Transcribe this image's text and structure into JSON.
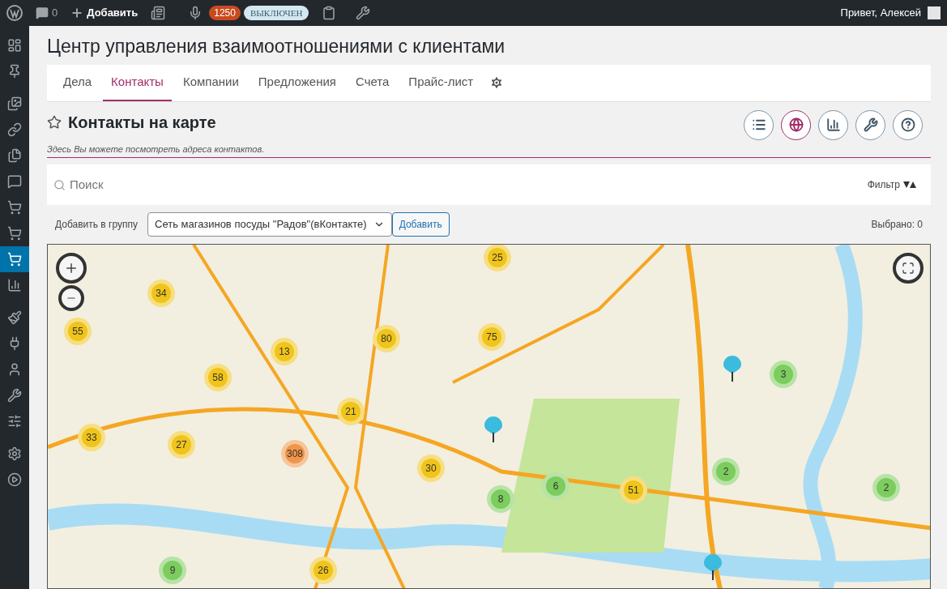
{
  "admin_bar": {
    "comments_count": "0",
    "add_label": "Добавить",
    "badge": "1250",
    "status_pill": "ВЫКЛЮЧЕН",
    "greeting": "Привет, Алексей"
  },
  "sidebar": {
    "items": [
      {
        "selected": false
      },
      {
        "selected": false
      },
      {
        "selected": false
      },
      {
        "selected": false
      },
      {
        "selected": false
      },
      {
        "selected": false
      },
      {
        "selected": false
      },
      {
        "selected": false
      },
      {
        "selected": true
      },
      {
        "selected": false
      },
      {
        "selected": false
      },
      {
        "selected": false
      },
      {
        "selected": false
      },
      {
        "selected": false
      },
      {
        "selected": false
      },
      {
        "selected": false
      },
      {
        "selected": false
      }
    ]
  },
  "page_title": "Центр управления взаимоотношениями с клиентами",
  "tabs": [
    {
      "label": "Дела",
      "selected": false
    },
    {
      "label": "Контакты",
      "selected": true
    },
    {
      "label": "Компании",
      "selected": false
    },
    {
      "label": "Предложения",
      "selected": false
    },
    {
      "label": "Счета",
      "selected": false
    },
    {
      "label": "Прайс-лист",
      "selected": false
    }
  ],
  "section": {
    "title": "Контакты на карте",
    "subtitle": "Здесь Вы можете посмотреть адреса контактов.",
    "view_buttons": [
      {
        "selected": false
      },
      {
        "selected": true
      },
      {
        "selected": false
      },
      {
        "selected": false
      },
      {
        "selected": false
      }
    ]
  },
  "search": {
    "placeholder": "Поиск",
    "filter_label": "Фильтр"
  },
  "group_bar": {
    "label": "Добавить в группу",
    "select_value": "Сеть магазинов посуды \"Радов\"(вКонтакте)",
    "button": "Добавить",
    "selected_count": "Выбрано: 0"
  },
  "map": {
    "clusters": [
      {
        "count": "34",
        "color": "#f0c419"
      },
      {
        "count": "55",
        "color": "#f0c419"
      },
      {
        "count": "13",
        "color": "#f0c419"
      },
      {
        "count": "80",
        "color": "#f0c419"
      },
      {
        "count": "25",
        "color": "#f0c419"
      },
      {
        "count": "75",
        "color": "#f0c419"
      },
      {
        "count": "58",
        "color": "#f0c419"
      },
      {
        "count": "21",
        "color": "#f0c419"
      },
      {
        "count": "33",
        "color": "#f0c419"
      },
      {
        "count": "27",
        "color": "#f0c419"
      },
      {
        "count": "308",
        "color": "#f0954a"
      },
      {
        "count": "30",
        "color": "#f0c419"
      },
      {
        "count": "8",
        "color": "#7ccc5e"
      },
      {
        "count": "6",
        "color": "#7ccc5e"
      },
      {
        "count": "51",
        "color": "#f0c419"
      },
      {
        "count": "2",
        "color": "#7ccc5e"
      },
      {
        "count": "3",
        "color": "#7ccc5e"
      },
      {
        "count": "2",
        "color": "#7ccc5e"
      },
      {
        "count": "9",
        "color": "#7ccc5e"
      },
      {
        "count": "26",
        "color": "#f0c419"
      }
    ]
  }
}
